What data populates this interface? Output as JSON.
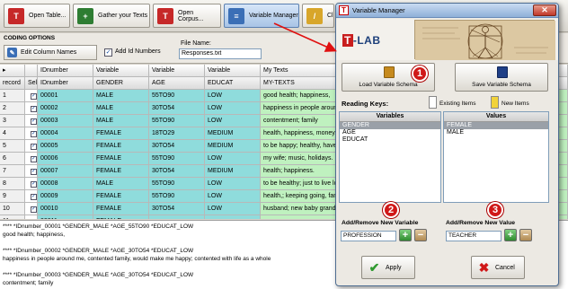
{
  "toolbar": {
    "buttons": [
      {
        "label": "Open Table...",
        "icon": "open-table-icon"
      },
      {
        "label": "Gather your Texts",
        "icon": "gather-texts-icon"
      },
      {
        "label": "Open Corpus...",
        "icon": "open-corpus-icon"
      },
      {
        "label": "Variable Manager",
        "icon": "variable-manager-icon"
      },
      {
        "label": "Cl",
        "icon": "broom-icon"
      }
    ]
  },
  "coding_options": {
    "title": "CODING OPTIONS",
    "edit_columns_label": "Edit Column Names",
    "add_id_label": "Add Id Numbers",
    "add_id_checked": true,
    "filename_label": "File Name:",
    "filename_value": "Responses.txt"
  },
  "grid": {
    "header_row1": [
      "IDnumber",
      "Variable",
      "Variable",
      "Variable",
      "My Texts"
    ],
    "header_row2": [
      "record",
      "Sel",
      "IDnumber",
      "GENDER",
      "AGE",
      "EDUCAT",
      "MY-TEXTS"
    ],
    "rows": [
      {
        "rec": "1",
        "id": "00001",
        "gender": "MALE",
        "age": "55TO90",
        "educat": "LOW",
        "text": "good health; happiness,"
      },
      {
        "rec": "2",
        "id": "00002",
        "gender": "MALE",
        "age": "30TO54",
        "educat": "LOW",
        "text": "happiness in people around m"
      },
      {
        "rec": "3",
        "id": "00003",
        "gender": "MALE",
        "age": "55TO90",
        "educat": "LOW",
        "text": "contentment; family"
      },
      {
        "rec": "4",
        "id": "00004",
        "gender": "FEMALE",
        "age": "18TO29",
        "educat": "MEDIUM",
        "text": "health, happiness, money, fri"
      },
      {
        "rec": "5",
        "id": "00005",
        "gender": "FEMALE",
        "age": "30TO54",
        "educat": "MEDIUM",
        "text": "to be happy; healthy, have a"
      },
      {
        "rec": "6",
        "id": "00006",
        "gender": "FEMALE",
        "age": "55TO90",
        "educat": "LOW",
        "text": "my wife; music, holidays. I li"
      },
      {
        "rec": "7",
        "id": "00007",
        "gender": "FEMALE",
        "age": "30TO54",
        "educat": "MEDIUM",
        "text": "health; happiness."
      },
      {
        "rec": "8",
        "id": "00008",
        "gender": "MALE",
        "age": "55TO90",
        "educat": "LOW",
        "text": "to be healthy; just to live lo"
      },
      {
        "rec": "9",
        "id": "00009",
        "gender": "FEMALE",
        "age": "55TO90",
        "educat": "LOW",
        "text": "health,; keeping going, fami"
      },
      {
        "rec": "10",
        "id": "00010",
        "gender": "FEMALE",
        "age": "30TO54",
        "educat": "LOW",
        "text": "husband; new baby grand da"
      },
      {
        "rec": "11",
        "id": "00011",
        "gender": "FEMALE",
        "age": "",
        "educat": "",
        "text": ""
      }
    ]
  },
  "log": {
    "lines": [
      "**** *IDnumber_00001 *GENDER_MALE *AGE_55TO90 *EDUCAT_LOW",
      "good health; happiness,",
      "",
      "**** *IDnumber_00002 *GENDER_MALE *AGE_30TO54 *EDUCAT_LOW",
      "happiness in people around me, contented family, would make me happy; contented with life as a whole",
      "",
      "**** *IDnumber_00003 *GENDER_MALE *AGE_30TO54 *EDUCAT_LOW",
      "contentment; family"
    ]
  },
  "dialog": {
    "title": "Variable Manager",
    "close_glyph": "✕",
    "logo_box": "T",
    "logo_rest": "-LAB",
    "load_schema_label": "Load Variable Schema",
    "save_schema_label": "Save Variable Schema",
    "reading_keys_label": "Reading Keys:",
    "existing_items_label": "Existing Items",
    "new_items_label": "New Items",
    "variables_header": "Variables",
    "values_header": "Values",
    "variables": [
      "GENDER",
      "AGE",
      "EDUCAT"
    ],
    "values": [
      "FEMALE",
      "MALE"
    ],
    "add_variable_label": "Add/Remove New Variable",
    "add_value_label": "Add/Remove New Value",
    "new_variable_value": "PROFESSION",
    "new_value_value": "TEACHER",
    "plus_glyph": "+",
    "minus_glyph": "−",
    "apply_label": "Apply",
    "cancel_label": "Cancel",
    "apply_glyph": "✔",
    "cancel_glyph": "✖"
  },
  "badges": [
    "1",
    "2",
    "3"
  ],
  "colors": {
    "accent_red": "#d01818",
    "grid_cyan": "#8fdcdc",
    "grid_green": "#bff1bf"
  }
}
